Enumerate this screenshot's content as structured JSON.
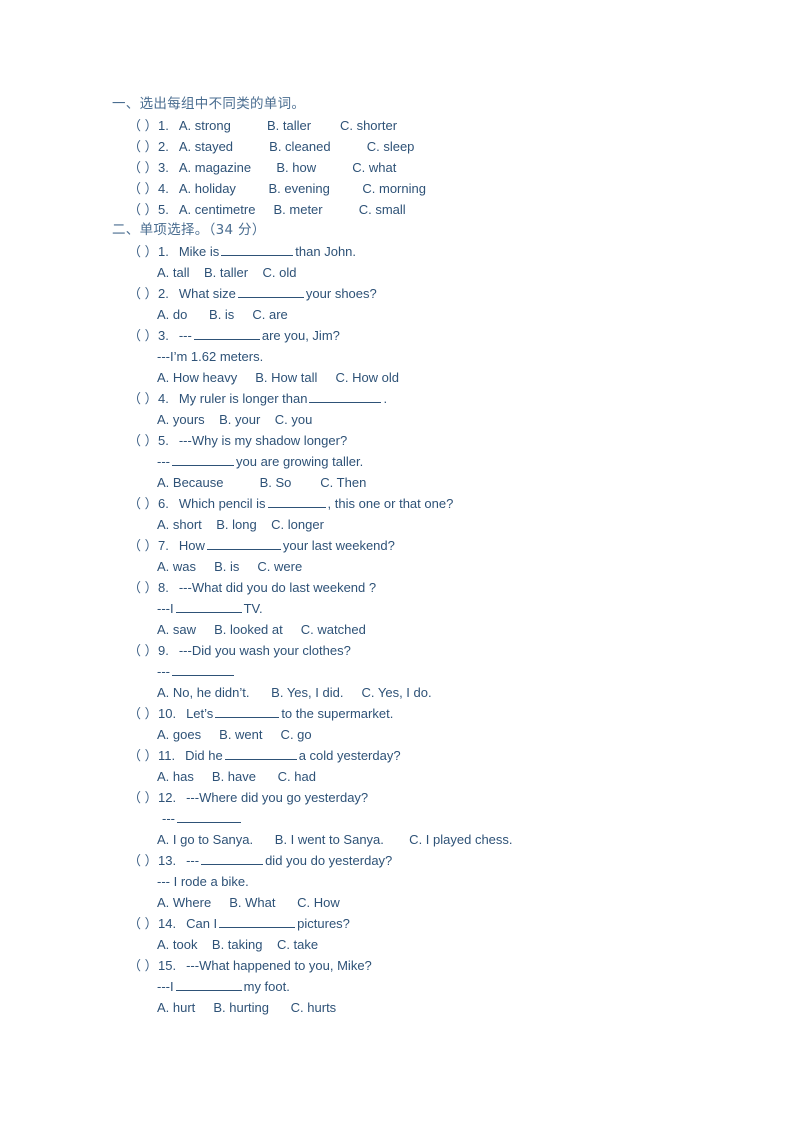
{
  "document": {
    "type": "worksheet",
    "ink_color": "#2e5277",
    "background_color": "#ffffff"
  },
  "sections": [
    {
      "id": "section-1",
      "header": "一、选出每组中不同类的单词。",
      "questions": [
        {
          "bracket": "（    ）",
          "number": "1.",
          "stem": "",
          "options_line": "A. strong          B. taller        C. shorter"
        },
        {
          "bracket": "（    ）",
          "number": "2.",
          "stem": "",
          "options_line": "A. stayed          B. cleaned          C. sleep"
        },
        {
          "bracket": "（    ）",
          "number": "3.",
          "stem": "",
          "options_line": "A. magazine       B. how          C. what"
        },
        {
          "bracket": "（    ）",
          "number": "4.",
          "stem": "",
          "options_line": "A. holiday         B. evening         C. morning"
        },
        {
          "bracket": "（    ）",
          "number": "5.",
          "stem": "",
          "options_line": "A. centimetre     B. meter          C. small"
        }
      ]
    },
    {
      "id": "section-2",
      "header": "二、单项选择。（34 分）",
      "questions": [
        {
          "bracket": "（    ）",
          "number": "1.",
          "stem_before": "Mike is",
          "stem_after": "than John.",
          "blank_width": 72,
          "reply": "",
          "options_line": "A. tall    B. taller    C. old"
        },
        {
          "bracket": "（    ）",
          "number": "2.",
          "stem_before": "What size",
          "stem_after": "your shoes?",
          "blank_width": 66,
          "reply": "",
          "options_line": "A. do      B. is     C. are"
        },
        {
          "bracket": "（    ）",
          "number": "3.",
          "stem_before": "---",
          "stem_after": "are you, Jim?",
          "blank_width": 66,
          "reply": "---I’m 1.62 meters.",
          "options_line": "A. How heavy     B. How tall     C. How old"
        },
        {
          "bracket": "（    ）",
          "number": "4.",
          "stem_before": "My ruler is longer than",
          "stem_after": ".",
          "blank_width": 72,
          "reply": "",
          "options_line": "A. yours    B. your    C. you"
        },
        {
          "bracket": "（    ）",
          "number": "5.",
          "stem_before": "---Why is my shadow longer?",
          "stem_after": "",
          "blank_width": 0,
          "reply_before": "---",
          "reply_blank_width": 62,
          "reply_after": "you are growing taller.",
          "options_line": "A. Because          B. So        C. Then"
        },
        {
          "bracket": "（    ）",
          "number": "6.",
          "stem_before": "Which pencil is",
          "stem_after": ", this one or that one?",
          "blank_width": 58,
          "reply": "",
          "options_line": "A. short    B. long    C. longer"
        },
        {
          "bracket": "（    ）",
          "number": "7.",
          "stem_before": "How",
          "stem_after": "your last weekend?",
          "blank_width": 74,
          "reply": "",
          "options_line": "A. was     B. is     C. were"
        },
        {
          "bracket": "（    ）",
          "number": "8.",
          "stem_before": "---What did you do last weekend ?",
          "stem_after": "",
          "blank_width": 0,
          "reply_before": "---I",
          "reply_blank_width": 66,
          "reply_after": "TV.",
          "options_line": "A. saw     B. looked at     C. watched"
        },
        {
          "bracket": "（    ）",
          "number": "9.",
          "stem_before": "---Did you wash your clothes?",
          "stem_after": "",
          "blank_width": 0,
          "reply_before": "---",
          "reply_blank_width": 62,
          "reply_after": "",
          "options_line": "A. No, he didn’t.      B. Yes, I did.     C. Yes, I do."
        },
        {
          "bracket": "（    ）",
          "number": "10.",
          "stem_before": "Let’s",
          "stem_after": "to the supermarket.",
          "blank_width": 64,
          "reply": "",
          "options_line": "A. goes     B. went     C. go"
        },
        {
          "bracket": "（    ）",
          "number": "11.",
          "stem_before": "Did he",
          "stem_after": "a cold yesterday?",
          "blank_width": 72,
          "reply": "",
          "options_line": "A. has     B. have      C. had"
        },
        {
          "bracket": "（    ）",
          "number": "12.",
          "stem_before": "---Where did you go yesterday?",
          "stem_after": "",
          "blank_width": 0,
          "reply_before": "---",
          "reply_blank_width": 64,
          "reply_after": "",
          "options_line": "A. I go to Sanya.      B. I went to Sanya.       C. I played chess."
        },
        {
          "bracket": "（    ）",
          "number": "13.",
          "stem_before": "---",
          "stem_after": "did you do yesterday?",
          "blank_width": 62,
          "reply": "--- I rode a bike.",
          "options_line": "A. Where     B. What      C. How"
        },
        {
          "bracket": "（    ）",
          "number": "14.",
          "stem_before": "Can I",
          "stem_after": "pictures?",
          "blank_width": 76,
          "reply": "",
          "options_line": "A. took    B. taking    C. take"
        },
        {
          "bracket": "（    ）",
          "number": "15.",
          "stem_before": "---What happened to you, Mike?",
          "stem_after": "",
          "blank_width": 0,
          "reply_before": "---I",
          "reply_blank_width": 66,
          "reply_after": "my foot.",
          "options_line": "A. hurt     B. hurting      C. hurts"
        }
      ]
    }
  ]
}
